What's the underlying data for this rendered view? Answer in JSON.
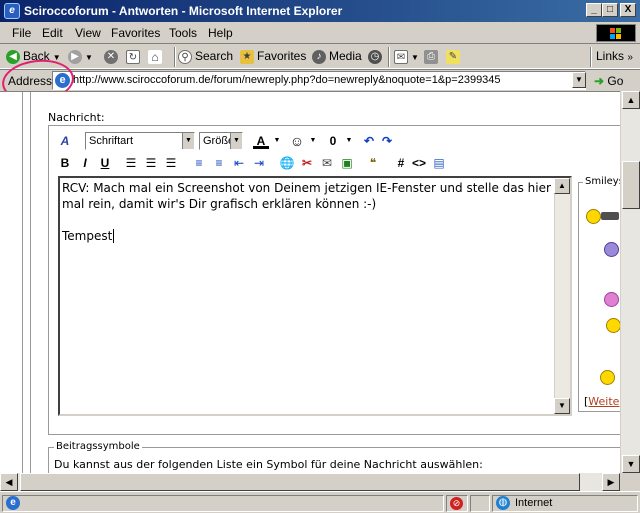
{
  "window": {
    "title": "Sciroccoforum - Antworten - Microsoft Internet Explorer",
    "minimize": "_",
    "maximize": "□",
    "close": "X"
  },
  "menu": [
    "File",
    "Edit",
    "View",
    "Favorites",
    "Tools",
    "Help"
  ],
  "toolbar": {
    "back": "Back",
    "search": "Search",
    "favorites": "Favorites",
    "media": "Media",
    "links": "Links"
  },
  "address": {
    "label": "Address",
    "url": "http://www.sciroccoforum.de/forum/newreply.php?do=newreply&noquote=1&p=2399345",
    "go": "Go"
  },
  "page": {
    "nachricht_label": "Nachricht:",
    "font_combo": "Schriftart",
    "size_combo": "Größe",
    "message_text": "RCV: Mach mal ein Screenshot von Deinem jetzigen IE-Fenster und stelle das hier mal rein, damit wir's Dir grafisch erklären können :-)\n\nTempest",
    "smileys_legend": "Smileys",
    "weiter_bracket": "[",
    "weiter_link": "Weite",
    "beitragssymbole_legend": "Beitragssymbole",
    "beitragssymbole_text": "Du kannst aus der folgenden Liste ein Symbol für deine Nachricht auswählen:"
  },
  "status": {
    "zone": "Internet"
  },
  "colors": {
    "titlebar_start": "#0a246a",
    "titlebar_end": "#3a6ea5",
    "annotation_circle": "#e02070",
    "link": "#b04020"
  }
}
